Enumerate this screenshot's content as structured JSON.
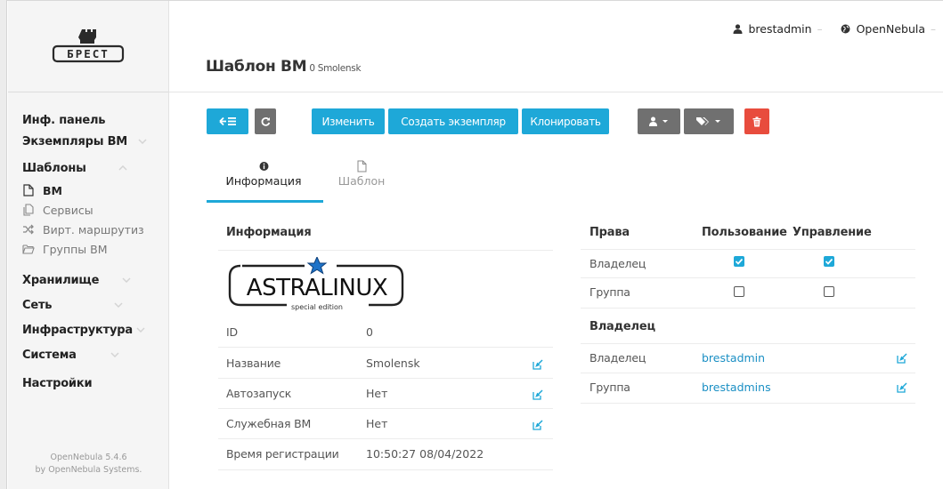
{
  "sidebar": {
    "logo_text": "БРЕСТ",
    "items": [
      {
        "label": "Инф. панель"
      },
      {
        "label": "Экземпляры ВМ"
      },
      {
        "label": "Шаблоны"
      },
      {
        "label": "Хранилище"
      },
      {
        "label": "Сеть"
      },
      {
        "label": "Инфраструктура"
      },
      {
        "label": "Система"
      },
      {
        "label": "Настройки"
      }
    ],
    "sub_items": [
      {
        "label": "ВМ",
        "icon": "file-icon"
      },
      {
        "label": "Сервисы",
        "icon": "files-icon"
      },
      {
        "label": "Вирт. маршрутиз",
        "icon": "shuffle-icon"
      },
      {
        "label": "Группы ВМ",
        "icon": "folder-icon"
      }
    ],
    "footer_line1": "OpenNebula 5.4.6",
    "footer_line2": "by OpenNebula Systems."
  },
  "header": {
    "title": "Шаблон ВМ",
    "subtitle": "0 Smolensk",
    "user": "brestadmin",
    "zone": "OpenNebula"
  },
  "toolbar": {
    "back_icon": "back-list-icon",
    "refresh_icon": "refresh-icon",
    "edit_label": "Изменить",
    "instantiate_label": "Создать экземпляр",
    "clone_label": "Клонировать",
    "owner_icon": "user-icon",
    "labels_icon": "tags-icon",
    "delete_icon": "trash-icon"
  },
  "tabs": [
    {
      "label": "Информация",
      "icon": "info-icon",
      "active": true
    },
    {
      "label": "Шаблон",
      "icon": "file-icon",
      "active": false
    }
  ],
  "info": {
    "title": "Информация",
    "logo_text": "ASTRALINUX",
    "logo_subtext": "special edition",
    "rows": [
      {
        "label": "ID",
        "value": "0"
      },
      {
        "label": "Название",
        "value": "Smolensk"
      },
      {
        "label": "Автозапуск",
        "value": "Нет"
      },
      {
        "label": "Служебная ВМ",
        "value": "Нет"
      },
      {
        "label": "Время регистрации",
        "value": "10:50:27 08/04/2022"
      }
    ]
  },
  "permissions": {
    "title": "Права",
    "col_use": "Пользование",
    "col_manage": "Управление",
    "rows": [
      {
        "label": "Владелец",
        "use": true,
        "manage": true
      },
      {
        "label": "Группа",
        "use": false,
        "manage": false
      }
    ]
  },
  "ownership": {
    "title": "Владелец",
    "rows": [
      {
        "label": "Владелец",
        "value": "brestadmin"
      },
      {
        "label": "Группа",
        "value": "brestadmins"
      }
    ]
  },
  "colors": {
    "accent": "#1ea8d8",
    "danger": "#e84c3d",
    "neutral": "#707070"
  }
}
